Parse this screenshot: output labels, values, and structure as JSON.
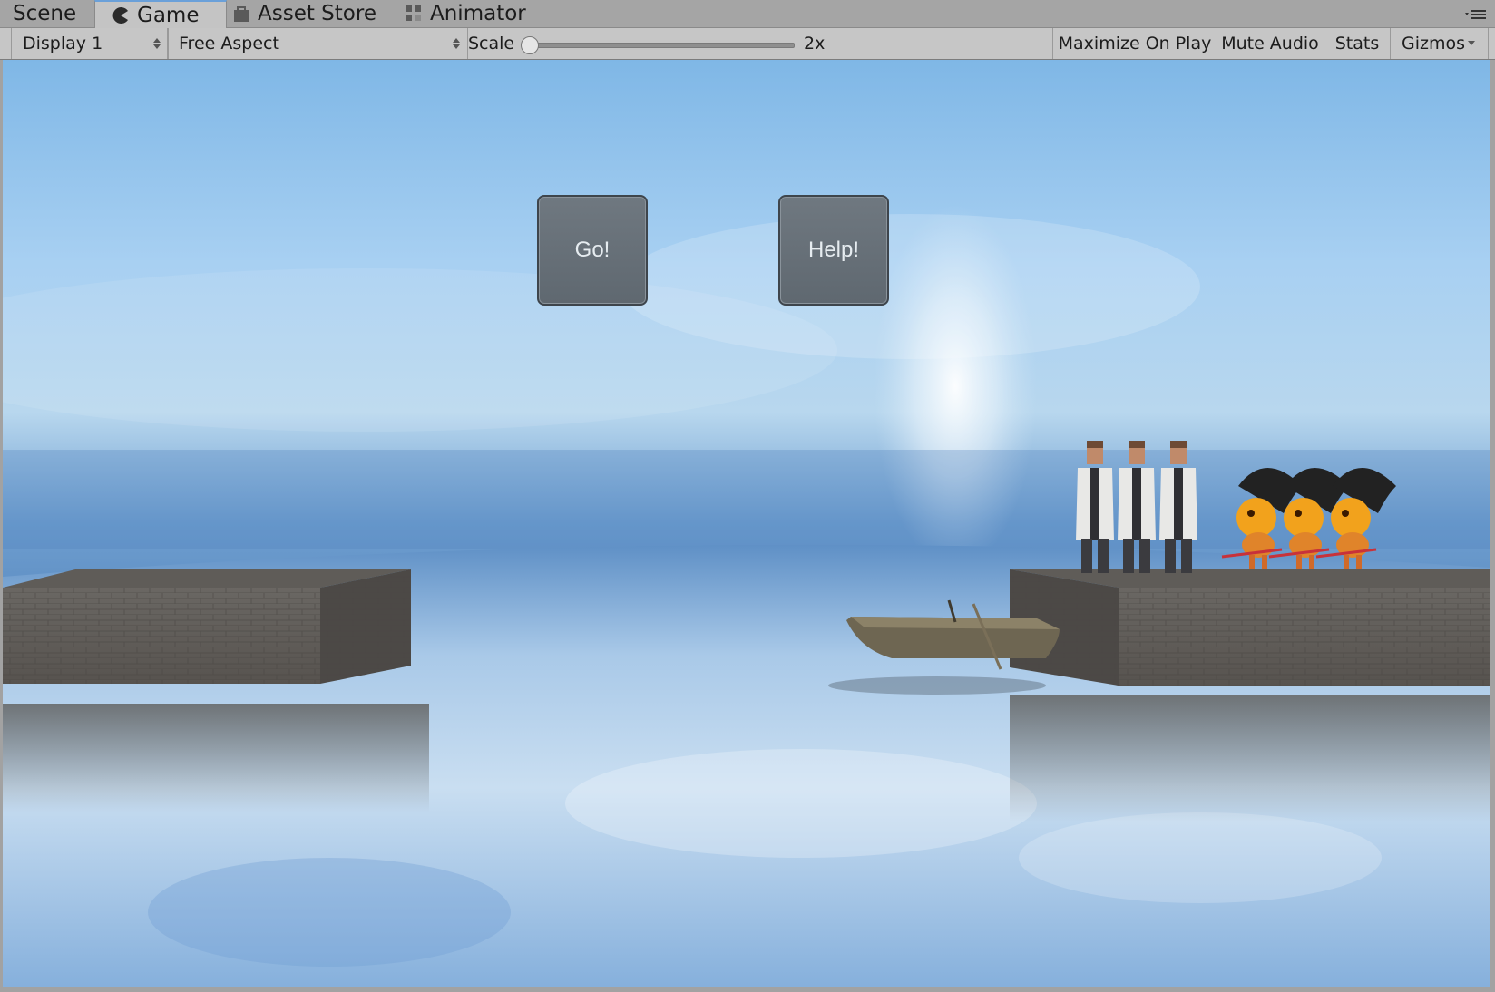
{
  "tabs": [
    {
      "label": "Scene",
      "icon": "none"
    },
    {
      "label": "Game",
      "icon": "pacman-icon",
      "active": true
    },
    {
      "label": "Asset Store",
      "icon": "store-bag-icon"
    },
    {
      "label": "Animator",
      "icon": "animator-nodes-icon"
    }
  ],
  "toolbar": {
    "display": "Display 1",
    "aspect": "Free Aspect",
    "scale_label": "Scale",
    "scale_value": "2x",
    "scale_slider_fraction": 0.0,
    "maximize": "Maximize On Play",
    "mute": "Mute Audio",
    "stats": "Stats",
    "gizmos": "Gizmos"
  },
  "game": {
    "go_button": "Go!",
    "help_button": "Help!",
    "scene_description": {
      "priests_on_right_bank": 3,
      "devils_on_right_bank": 3,
      "boat_side": "right"
    }
  },
  "colors": {
    "active_tab_accent": "#6aa0d9",
    "game_button_bg": "#66707a",
    "sky_light": "#b8d7ee",
    "water": "#7fa8d6"
  }
}
